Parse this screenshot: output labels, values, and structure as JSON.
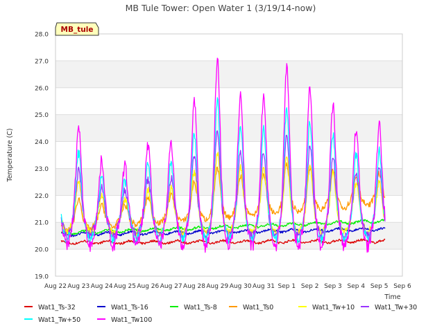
{
  "chart_data": {
    "type": "line",
    "title": "MB Tule Tower: Open Water 1 (3/19/14-now)",
    "xlabel": "Time",
    "ylabel": "Temperature (C)",
    "ylim": [
      19.0,
      28.0
    ],
    "yticks": [
      "19.0",
      "20.0",
      "21.0",
      "22.0",
      "23.0",
      "24.0",
      "25.0",
      "26.0",
      "27.0",
      "28.0"
    ],
    "xlim_days": [
      22,
      37
    ],
    "xticks": [
      "Aug 22",
      "Aug 23",
      "Aug 24",
      "Aug 25",
      "Aug 26",
      "Aug 27",
      "Aug 28",
      "Aug 29",
      "Aug 30",
      "Aug 31",
      "Sep 1",
      "Sep 2",
      "Sep 3",
      "Sep 4",
      "Sep 5",
      "Sep 6"
    ],
    "grid": true,
    "banded_background": true,
    "station_label": "MB_tule",
    "legend_position": "bottom",
    "series": [
      {
        "name": "Wat1_Ts-32",
        "color": "#dd0000",
        "base": 20.25,
        "spread": 0.12
      },
      {
        "name": "Wat1_Ts-16",
        "color": "#0000cc",
        "base": 20.55,
        "spread": 0.2
      },
      {
        "name": "Wat1_Ts-8",
        "color": "#00ee00",
        "base": 20.6,
        "spread": 0.4
      },
      {
        "name": "Wat1_Ts0",
        "color": "#ff9900",
        "base": 20.9,
        "spread": 1.0
      },
      {
        "name": "Wat1_Tw+10",
        "color": "#ffff00",
        "base": 21.0,
        "spread": 1.6
      },
      {
        "name": "Wat1_Tw+30",
        "color": "#9933ff",
        "base": 21.0,
        "spread": 2.1
      },
      {
        "name": "Wat1_Tw+50",
        "color": "#00ffff",
        "base": 21.0,
        "spread": 2.8
      },
      {
        "name": "Wat1_Tw100",
        "color": "#ff00ff",
        "base": 21.0,
        "spread": 3.8
      }
    ],
    "daily_peaks_tw100": [
      {
        "day": 23.0,
        "value": 24.5
      },
      {
        "day": 24.0,
        "value": 23.3
      },
      {
        "day": 25.0,
        "value": 23.1
      },
      {
        "day": 26.0,
        "value": 23.9
      },
      {
        "day": 27.0,
        "value": 24.0
      },
      {
        "day": 28.0,
        "value": 25.5
      },
      {
        "day": 29.0,
        "value": 27.1
      },
      {
        "day": 30.0,
        "value": 25.8
      },
      {
        "day": 31.0,
        "value": 25.7
      },
      {
        "day": 32.0,
        "value": 26.8
      },
      {
        "day": 33.0,
        "value": 26.1
      },
      {
        "day": 34.0,
        "value": 25.4
      },
      {
        "day": 35.0,
        "value": 24.4
      },
      {
        "day": 36.0,
        "value": 24.6
      }
    ]
  }
}
